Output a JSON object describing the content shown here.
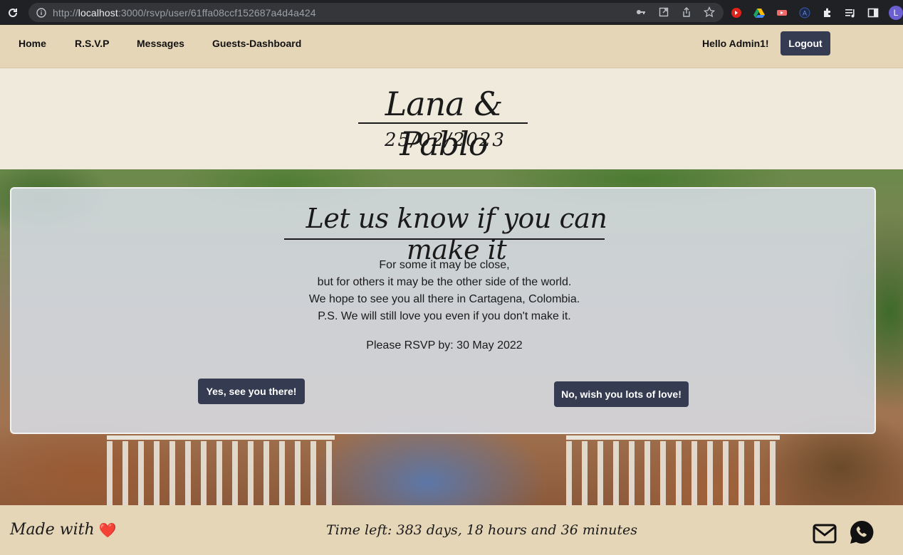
{
  "browser": {
    "url_prefix": "http://",
    "url_host": "localhost",
    "url_rest": ":3000/rsvp/user/61ffa08ccf152687a4d4a424",
    "avatar_letter": "L",
    "icons": [
      "reload-icon",
      "info-icon",
      "key-icon",
      "open-external-icon",
      "share-icon",
      "star-icon",
      "extension-red-icon",
      "drive-icon",
      "extension-arrow-icon",
      "extension-a-icon",
      "puzzle-icon",
      "media-icon",
      "sidebar-icon"
    ]
  },
  "nav": {
    "items": [
      {
        "label": "Home"
      },
      {
        "label": "R.S.V.P"
      },
      {
        "label": "Messages"
      },
      {
        "label": "Guests-Dashboard"
      }
    ],
    "greeting": "Hello Admin1!",
    "logout_label": "Logout"
  },
  "header": {
    "couple": "Lana & Pablo",
    "date": "25/02/2023"
  },
  "card": {
    "title": "Let us know if you can make it",
    "lines": [
      "For some it may be close,",
      "but for others it may be the other side of the world.",
      "We hope to see you all there in Cartagena, Colombia.",
      "P.S. We will still love you even if you don't make it."
    ],
    "deadline": "Please RSVP by: 30 May 2022",
    "yes_label": "Yes, see you there!",
    "no_label": "No, wish you lots of love!"
  },
  "footer": {
    "made_with": "Made with",
    "heart": "❤️",
    "time_left": "Time left: 383 days, 18 hours and 36 minutes"
  },
  "colors": {
    "nav_bg": "#e6d6b8",
    "page_bg": "#efeadb",
    "button_bg": "#353b50",
    "card_bg": "#d8dee8"
  }
}
